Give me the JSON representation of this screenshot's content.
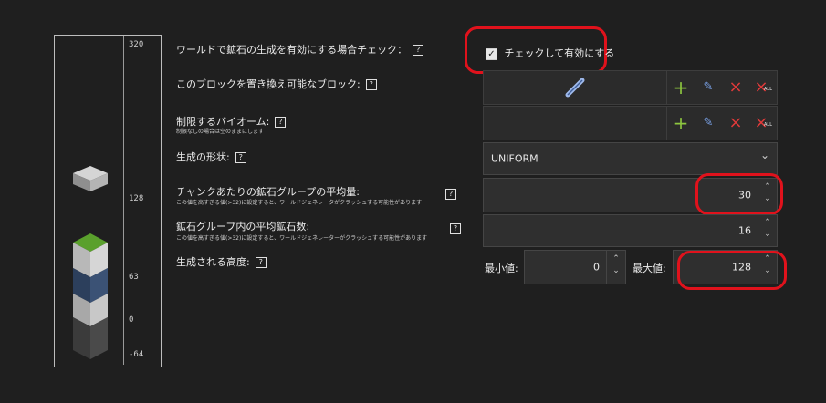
{
  "scale": {
    "ticks": [
      "320",
      "128",
      "63",
      "0",
      "-64"
    ]
  },
  "rows": {
    "checkbox_row": {
      "label": "ワールドで鉱石の生成を有効にする場合チェック：",
      "help": "?"
    },
    "blocks_row": {
      "label": "このブロックを置き換え可能なブロック:",
      "help": "?"
    },
    "biome_row": {
      "label": "制限するバイオーム:",
      "sub": "制限なしの場合は空のままにします",
      "help": "?"
    },
    "shape_row": {
      "label": "生成の形状:",
      "help": "?"
    },
    "avg_groups_row": {
      "label": "チャンクあたりの鉱石グループの平均量:",
      "sub": "この値を高すぎる値(>32)に設定すると、ワールドジェネレータがクラッシュする可能性があります",
      "help": "?"
    },
    "avg_ores_row": {
      "label": "鉱石グループ内の平均鉱石数:",
      "sub": "この値を高すぎる値(>32)に設定すると、ワールドジェネレーターがクラッシュする可能性があります",
      "help": "?"
    },
    "height_row": {
      "label": "生成される高度:",
      "help": "?"
    }
  },
  "controls": {
    "enable_checkbox_label": "チェックして有効にする",
    "shape_select_value": "UNIFORM",
    "avg_groups_value": "30",
    "avg_ores_value": "16",
    "min_label": "最小値:",
    "min_value": "0",
    "max_label": "最大値:",
    "max_value": "128"
  },
  "icons": {
    "add": "+",
    "edit": "pencil-plus",
    "remove": "×",
    "remove_all": "× ALL",
    "remove_all_text": "ALL",
    "spin_up": "⌃",
    "spin_down": "⌄",
    "chevron": "⌄",
    "checkmark": "✓"
  },
  "colors": {
    "accent_red": "#e0121c",
    "add_green": "#8dc63f",
    "remove_red": "#e03a3a",
    "edit_blue": "#7aa2e8"
  }
}
